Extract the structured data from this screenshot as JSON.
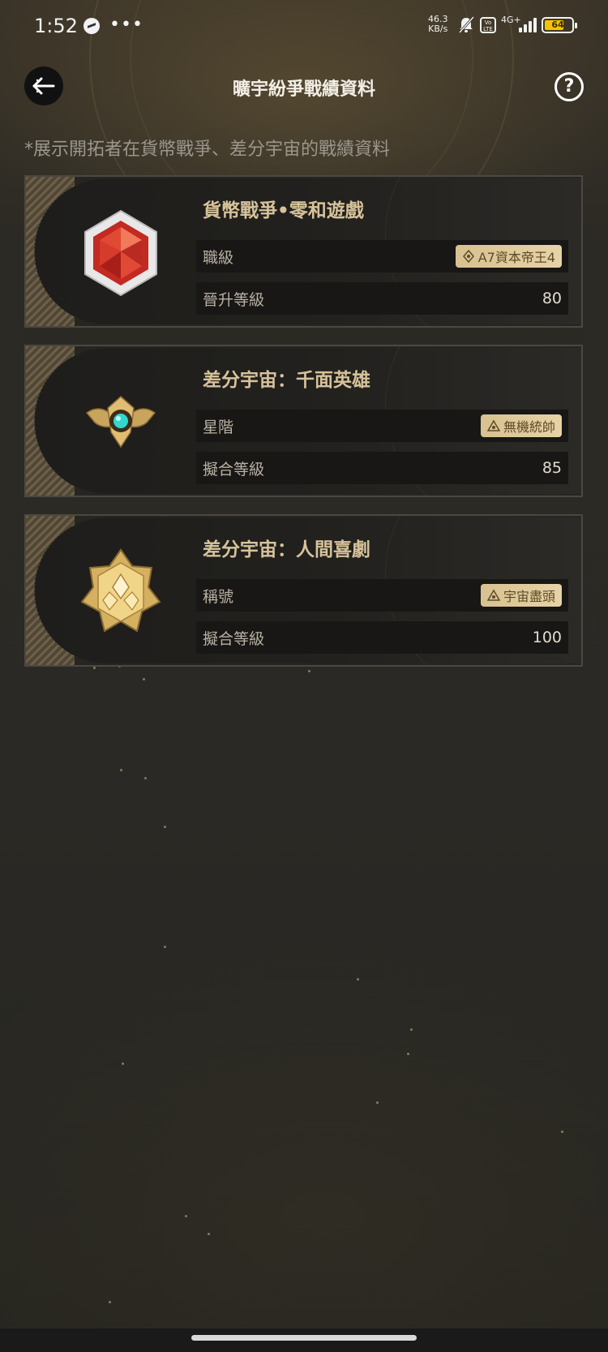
{
  "status_bar": {
    "time": "1:52",
    "dots": "•••",
    "speed_value": "46.3",
    "speed_unit": "KB/s",
    "volte": "Vo LTE",
    "network": "4G+",
    "battery_level": "64"
  },
  "header": {
    "title": "曠宇紛爭戰績資料",
    "help_label": "?"
  },
  "subtitle": "*展示開拓者在貨幣戰爭、差分宇宙的戰績資料",
  "cards": [
    {
      "title": "貨幣戰爭•零和遊戲",
      "emblem": "red-gem-emblem",
      "rows": [
        {
          "label": "職級",
          "badge": "A7資本帝王4"
        },
        {
          "label": "晉升等級",
          "value": "80"
        }
      ]
    },
    {
      "title": "差分宇宙：千面英雄",
      "emblem": "gold-winged-emblem",
      "rows": [
        {
          "label": "星階",
          "badge": "無機統帥"
        },
        {
          "label": "擬合等級",
          "value": "85"
        }
      ]
    },
    {
      "title": "差分宇宙：人間喜劇",
      "emblem": "gold-star-emblem",
      "rows": [
        {
          "label": "稱號",
          "badge": "宇宙盡頭"
        },
        {
          "label": "擬合等級",
          "value": "100"
        }
      ]
    }
  ],
  "colors": {
    "accent_gold": "#d7c39a",
    "badge_bg": "#e0cb9c",
    "card_bg": "#262522"
  }
}
